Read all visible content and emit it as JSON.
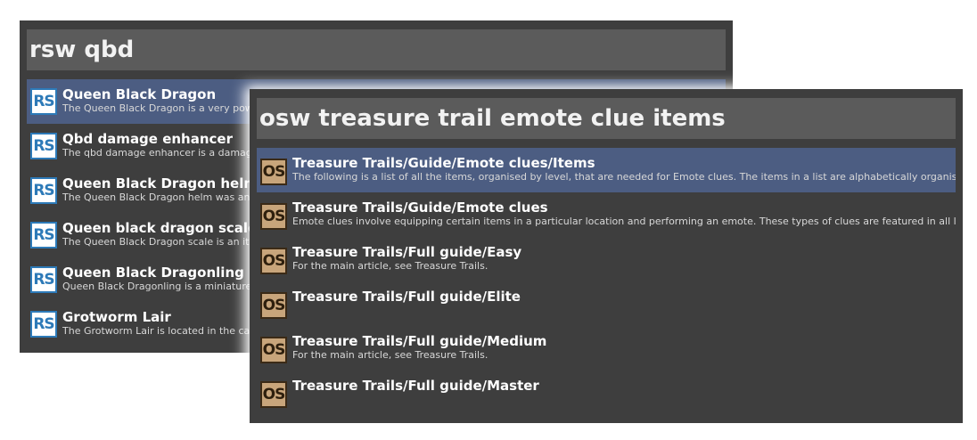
{
  "rs_launcher": {
    "query": "rsw qbd",
    "icon_label": "RS",
    "results": [
      {
        "title": "Queen Black Dragon",
        "desc": "The Queen Black Dragon is a very pow"
      },
      {
        "title": "Qbd damage enhancer",
        "desc": "The qbd damage enhancer is a damag"
      },
      {
        "title": "Queen Black Dragon helm",
        "desc": "The Queen Black Dragon helm was an"
      },
      {
        "title": "Queen black dragon scale",
        "desc": "The Queen Black Dragon scale is an ite"
      },
      {
        "title": "Queen Black Dragonling",
        "desc": "Queen Black Dragonling is a miniature"
      },
      {
        "title": "Grotworm Lair",
        "desc": "The Grotworm Lair is located in the ca"
      }
    ]
  },
  "os_launcher": {
    "query": "osw treasure trail emote clue items",
    "icon_label": "OS",
    "results": [
      {
        "title": "Treasure Trails/Guide/Emote clues/Items",
        "desc": "The following is a list of all the items, organised by level, that are needed for Emote clues. The items in a list are alphabetically organised."
      },
      {
        "title": "Treasure Trails/Guide/Emote clues",
        "desc": "Emote clues involve equipping certain items in a particular location and performing an emote. These types of clues are featured in all levels"
      },
      {
        "title": "Treasure Trails/Full guide/Easy",
        "desc": "For the main article, see Treasure Trails."
      },
      {
        "title": "Treasure Trails/Full guide/Elite",
        "desc": ""
      },
      {
        "title": "Treasure Trails/Full guide/Medium",
        "desc": "For the main article, see Treasure Trails."
      },
      {
        "title": "Treasure Trails/Full guide/Master",
        "desc": ""
      }
    ]
  },
  "colors": {
    "launcher_bg": "#3e3e3e",
    "query_bg": "#5b5b5b",
    "selected_bg": "#4c5d82",
    "rs_icon_border": "#2d7ab8",
    "os_icon_bg": "#c8a57b"
  },
  "icons": {
    "rs": "runescape-wiki-icon",
    "os": "oldschool-wiki-icon"
  }
}
